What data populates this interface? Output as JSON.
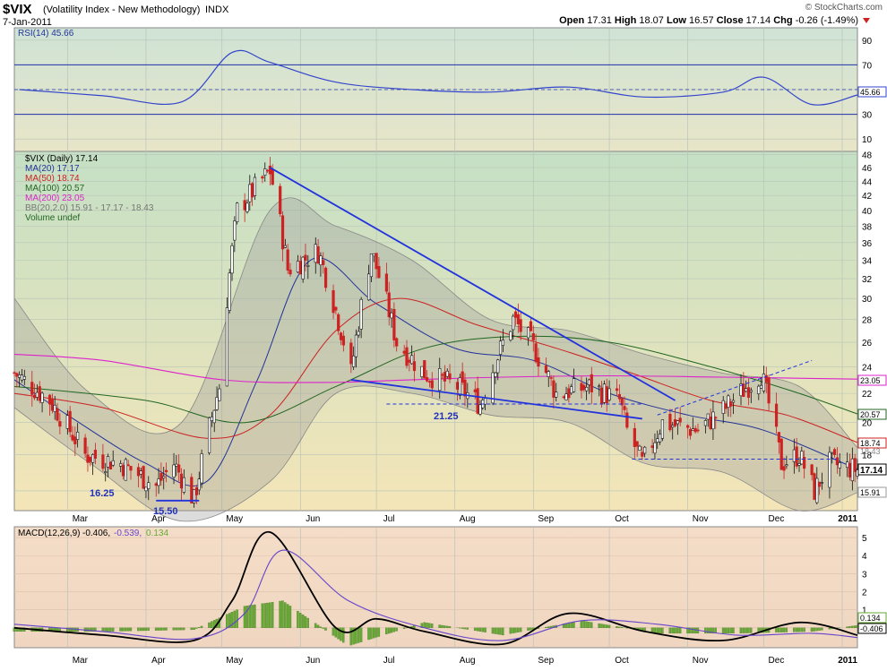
{
  "header": {
    "symbol": "$VIX",
    "name": "(Volatility Index - New Methodology)",
    "exchange": "INDX",
    "date": "7-Jan-2011",
    "watermark": "© StockCharts.com",
    "quote": {
      "open_label": "Open",
      "open": "17.31",
      "high_label": "High",
      "high": "18.07",
      "low_label": "Low",
      "low": "16.57",
      "close_label": "Close",
      "close": "17.14",
      "chg_label": "Chg",
      "chg": "-0.26 (-1.49%)"
    }
  },
  "colors": {
    "bull": "#111111",
    "bear": "#cc2222",
    "ma20": "#223399",
    "ma50": "#cc2222",
    "ma100": "#226622",
    "ma200": "#dd22cc",
    "bands": "#999999",
    "trend": "#2233dd",
    "rsi": "#3344cc",
    "macd": "#000000",
    "signal": "#6644cc",
    "hist": "#66aa33"
  },
  "legend": {
    "price": "$VIX (Daily) 17.14",
    "ma20": "MA(20) 17.17",
    "ma50": "MA(50) 18.74",
    "ma100": "MA(100) 20.57",
    "ma200": "MA(200) 23.05",
    "bb": "BB(20,2.0) 15.91 - 17.17 - 18.43",
    "vol": "Volume undef",
    "rsi": "RSI(14) 45.66",
    "macd_name": "MACD(12,26,9)",
    "macd_v": "-0.406,",
    "macd_s": "-0.539,",
    "macd_h": "0.134"
  },
  "annotations": {
    "a1": "16.25",
    "a2": "15.50",
    "a3": "21.25"
  },
  "right_tags": {
    "t1": "23.05",
    "t2": "20.57",
    "t3": "18.74",
    "t4": "18.43",
    "t5": "17.14",
    "t6": "15.91",
    "rsi": "45.66",
    "macd_h": "0.134",
    "macd_v": "-0.406"
  },
  "chart_data": [
    {
      "type": "line",
      "panel": "RSI",
      "x_range": [
        "2010-02-08",
        "2011-01-07"
      ],
      "y_ticks": [
        10,
        30,
        50,
        70,
        90
      ],
      "ylim": [
        0,
        100
      ],
      "reference_lines": [
        30,
        70
      ],
      "series": [
        {
          "name": "RSI(14)",
          "x": [
            "2010-02-10",
            "2010-03-15",
            "2010-04-15",
            "2010-05-05",
            "2010-05-20",
            "2010-06-15",
            "2010-07-15",
            "2010-08-15",
            "2010-09-15",
            "2010-10-15",
            "2010-11-15",
            "2010-12-01",
            "2010-12-20",
            "2011-01-07"
          ],
          "y": [
            50,
            45,
            40,
            80,
            72,
            56,
            50,
            48,
            52,
            44,
            48,
            60,
            38,
            45.66
          ]
        }
      ]
    },
    {
      "type": "line",
      "panel": "Price",
      "x_range": [
        "2010-02-08",
        "2011-01-07"
      ],
      "y_ticks": [
        16,
        18,
        20,
        22,
        24,
        26,
        28,
        30,
        32,
        34,
        36,
        38,
        40,
        42,
        44,
        46,
        48
      ],
      "ylim": [
        15,
        48.5
      ],
      "series": [
        {
          "name": "$VIX (Daily)",
          "x": [
            "2010-02-08",
            "2010-02-22",
            "2010-03-08",
            "2010-03-22",
            "2010-04-05",
            "2010-04-12",
            "2010-04-20",
            "2010-04-30",
            "2010-05-07",
            "2010-05-20",
            "2010-05-27",
            "2010-06-08",
            "2010-06-21",
            "2010-06-29",
            "2010-07-09",
            "2010-07-20",
            "2010-08-02",
            "2010-08-11",
            "2010-08-24",
            "2010-08-31",
            "2010-09-10",
            "2010-09-24",
            "2010-10-05",
            "2010-10-08",
            "2010-10-14",
            "2010-10-22",
            "2010-11-05",
            "2010-11-16",
            "2010-11-30",
            "2010-12-08",
            "2010-12-15",
            "2010-12-21",
            "2010-12-27",
            "2011-01-07"
          ],
          "y": [
            23.5,
            21.5,
            18.0,
            17.5,
            16.25,
            17.5,
            15.5,
            22.5,
            40.0,
            45.5,
            33.0,
            35.0,
            23.5,
            35.0,
            26.0,
            23.5,
            22.5,
            21.25,
            28.0,
            26.0,
            22.0,
            22.5,
            21.5,
            19.5,
            17.5,
            20.0,
            19.5,
            21.0,
            23.5,
            17.5,
            18.0,
            16.0,
            17.5,
            17.14
          ]
        },
        {
          "name": "MA(20)",
          "x": [
            "2010-02-08",
            "2010-03-01",
            "2010-04-01",
            "2010-04-25",
            "2010-05-15",
            "2010-06-05",
            "2010-07-01",
            "2010-08-01",
            "2010-09-01",
            "2010-10-01",
            "2010-11-01",
            "2010-12-01",
            "2011-01-07"
          ],
          "y": [
            23.0,
            20.5,
            17.5,
            16.5,
            23.0,
            34.0,
            29.5,
            25.5,
            24.5,
            22.0,
            20.5,
            19.5,
            17.17
          ]
        },
        {
          "name": "MA(50)",
          "x": [
            "2010-02-08",
            "2010-03-15",
            "2010-04-25",
            "2010-05-20",
            "2010-06-15",
            "2010-07-10",
            "2010-08-10",
            "2010-09-10",
            "2010-10-10",
            "2010-11-10",
            "2010-12-10",
            "2011-01-07"
          ],
          "y": [
            22.0,
            21.0,
            19.0,
            20.5,
            27.0,
            30.0,
            27.5,
            25.5,
            23.5,
            21.5,
            20.5,
            18.74
          ]
        },
        {
          "name": "MA(100)",
          "x": [
            "2010-02-08",
            "2010-04-01",
            "2010-05-10",
            "2010-06-15",
            "2010-07-20",
            "2010-08-25",
            "2010-10-01",
            "2010-11-10",
            "2010-12-15",
            "2011-01-07"
          ],
          "y": [
            22.5,
            21.5,
            20.0,
            22.5,
            25.5,
            26.5,
            26.0,
            24.0,
            22.0,
            20.57
          ]
        },
        {
          "name": "MA(200)",
          "x": [
            "2010-02-08",
            "2010-03-15",
            "2010-05-01",
            "2010-06-10",
            "2010-07-15",
            "2010-08-20",
            "2010-10-01",
            "2010-11-15",
            "2011-01-07"
          ],
          "y": [
            25.0,
            24.5,
            23.0,
            22.8,
            23.0,
            23.2,
            23.3,
            23.2,
            23.05
          ]
        },
        {
          "name": "BB Upper",
          "x": [
            "2010-02-08",
            "2010-03-10",
            "2010-04-15",
            "2010-05-20",
            "2010-06-15",
            "2010-07-15",
            "2010-08-15",
            "2010-09-15",
            "2010-10-15",
            "2010-11-15",
            "2010-12-15",
            "2011-01-07"
          ],
          "y": [
            30.0,
            22.0,
            20.0,
            40.0,
            38.0,
            34.0,
            28.0,
            27.0,
            25.0,
            23.5,
            22.5,
            18.43
          ]
        },
        {
          "name": "BB Lower",
          "x": [
            "2010-02-08",
            "2010-03-10",
            "2010-04-15",
            "2010-05-20",
            "2010-06-15",
            "2010-07-15",
            "2010-08-15",
            "2010-09-15",
            "2010-10-15",
            "2010-11-15",
            "2010-12-15",
            "2011-01-07"
          ],
          "y": [
            21.0,
            17.5,
            14.5,
            16.5,
            22.0,
            22.0,
            20.5,
            20.0,
            17.5,
            17.0,
            15.0,
            15.91
          ]
        }
      ],
      "trendlines": [
        {
          "x": [
            "2010-05-20",
            "2010-10-27"
          ],
          "y": [
            46.0,
            21.5
          ]
        },
        {
          "x": [
            "2010-06-21",
            "2010-10-14"
          ],
          "y": [
            23.0,
            20.25
          ]
        },
        {
          "x": [
            "2010-04-05",
            "2010-04-22"
          ],
          "y": [
            15.5,
            15.5
          ]
        },
        {
          "x": [
            "2010-10-20",
            "2010-12-20"
          ],
          "y": [
            20.5,
            24.5
          ]
        }
      ],
      "support_lines": [
        {
          "x": [
            "2010-07-05",
            "2010-10-15"
          ],
          "y": [
            21.25,
            21.25
          ]
        },
        {
          "x": [
            "2010-10-10",
            "2010-12-31"
          ],
          "y": [
            17.75,
            17.75
          ]
        }
      ]
    },
    {
      "type": "line",
      "panel": "MACD",
      "x_range": [
        "2010-02-08",
        "2011-01-07"
      ],
      "y_ticks": [
        0,
        1,
        2,
        3,
        4,
        5
      ],
      "ylim": [
        -1.1,
        5.6
      ],
      "series": [
        {
          "name": "MACD",
          "x": [
            "2010-02-08",
            "2010-03-15",
            "2010-04-20",
            "2010-05-05",
            "2010-05-20",
            "2010-06-15",
            "2010-07-01",
            "2010-07-20",
            "2010-08-20",
            "2010-09-15",
            "2010-10-15",
            "2010-11-15",
            "2010-12-15",
            "2011-01-07"
          ],
          "y": [
            0.0,
            -0.4,
            -0.7,
            1.5,
            5.3,
            0.0,
            0.5,
            -0.2,
            -0.9,
            0.8,
            -0.2,
            -0.7,
            0.3,
            -0.406
          ]
        },
        {
          "name": "Signal",
          "x": [
            "2010-02-08",
            "2010-03-15",
            "2010-04-20",
            "2010-05-10",
            "2010-05-25",
            "2010-06-20",
            "2010-07-20",
            "2010-08-20",
            "2010-09-20",
            "2010-10-20",
            "2010-11-20",
            "2010-12-20",
            "2011-01-07"
          ],
          "y": [
            0.2,
            -0.2,
            -0.6,
            0.8,
            4.3,
            1.5,
            0.0,
            -0.7,
            0.4,
            0.2,
            -0.4,
            -0.3,
            -0.539
          ]
        },
        {
          "name": "Histogram",
          "x": [
            "2010-03-15",
            "2010-04-20",
            "2010-05-10",
            "2010-05-25",
            "2010-06-20",
            "2010-07-20",
            "2010-08-20",
            "2010-09-20",
            "2010-10-20",
            "2010-11-20",
            "2010-12-20",
            "2011-01-07"
          ],
          "y": [
            -0.2,
            -0.1,
            1.2,
            1.5,
            -1.0,
            0.3,
            -0.4,
            0.4,
            -0.3,
            -0.3,
            -0.2,
            0.134
          ]
        }
      ]
    }
  ],
  "x_axis": {
    "months": [
      "Mar",
      "Apr",
      "May",
      "Jun",
      "Jul",
      "Aug",
      "Sep",
      "Oct",
      "Nov",
      "Dec",
      "2011"
    ]
  }
}
